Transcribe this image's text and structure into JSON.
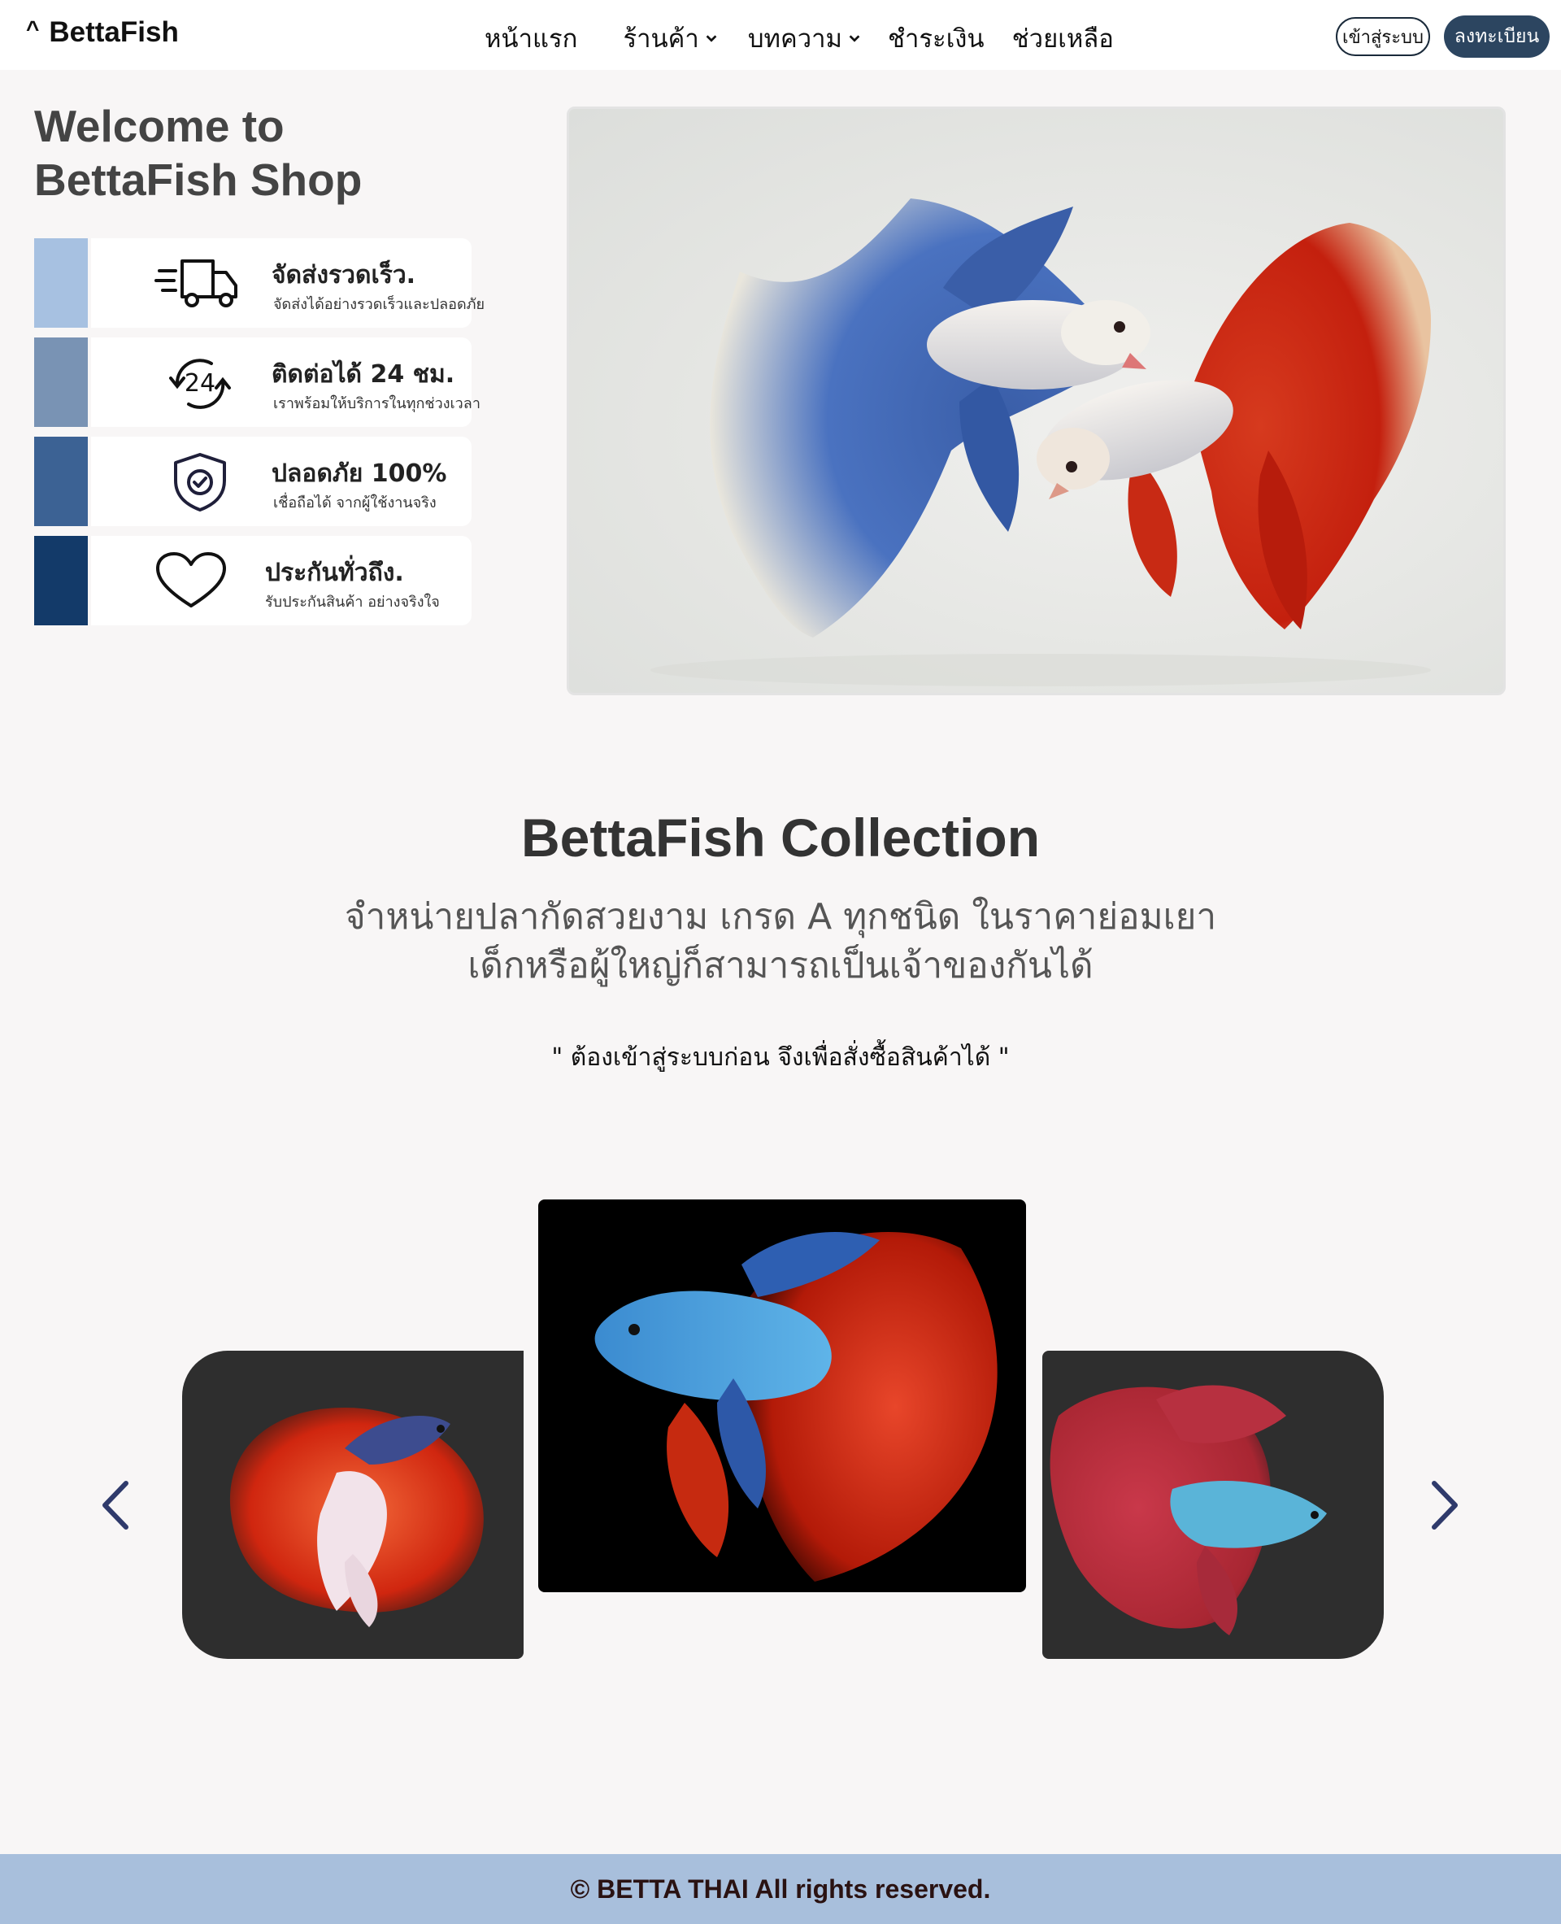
{
  "nav": {
    "logo": "BettaFish",
    "items": [
      {
        "label": "หน้าแรก",
        "dropdown": false
      },
      {
        "label": "ร้านค้า",
        "dropdown": true
      },
      {
        "label": "บทความ",
        "dropdown": true
      },
      {
        "label": "ชำระเงิน",
        "dropdown": false
      },
      {
        "label": "ช่วยเหลือ",
        "dropdown": false
      }
    ],
    "login_label": "เข้าสู่ระบบ",
    "register_label": "ลงทะเบียน"
  },
  "hero": {
    "title_line1": "Welcome to",
    "title_line2": "BettaFish Shop",
    "features": [
      {
        "icon": "delivery-truck-icon",
        "title": "จัดส่งรวดเร็ว.",
        "desc": "จัดส่งได้อย่างรวดเร็วและปลอดภัย",
        "color": "#a7c1e1"
      },
      {
        "icon": "clock-24-icon",
        "title": "ติดต่อได้ 24 ชม.",
        "desc": "เราพร้อมให้บริการในทุกช่วงเวลา",
        "color": "#7993b4"
      },
      {
        "icon": "shield-check-icon",
        "title": "ปลอดภัย 100%",
        "desc": "เชื่อถือได้ จากผู้ใช้งานจริง",
        "color": "#3c6294"
      },
      {
        "icon": "heart-icon",
        "title": "ประกันทั่วถึง.",
        "desc": "รับประกันสินค้า อย่างจริงใจ",
        "color": "#133a69"
      }
    ]
  },
  "collection": {
    "title": "BettaFish Collection",
    "subtitle_line1": "จำหน่ายปลากัดสวยงาม เกรด A ทุกชนิด ในราคาย่อมเยา",
    "subtitle_line2": "เด็กหรือผู้ใหญ่ก็สามารถเป็นเจ้าของกันได้",
    "note": "\" ต้องเข้าสู่ระบบก่อน จึงเพื่อสั่งซื้อสินค้าได้ \""
  },
  "colors": {
    "accent": "#2c4560",
    "arrow": "#2f3a6b",
    "footer_bg": "#a8bfdc"
  },
  "footer": {
    "text": "© BETTA THAI All rights reserved."
  }
}
